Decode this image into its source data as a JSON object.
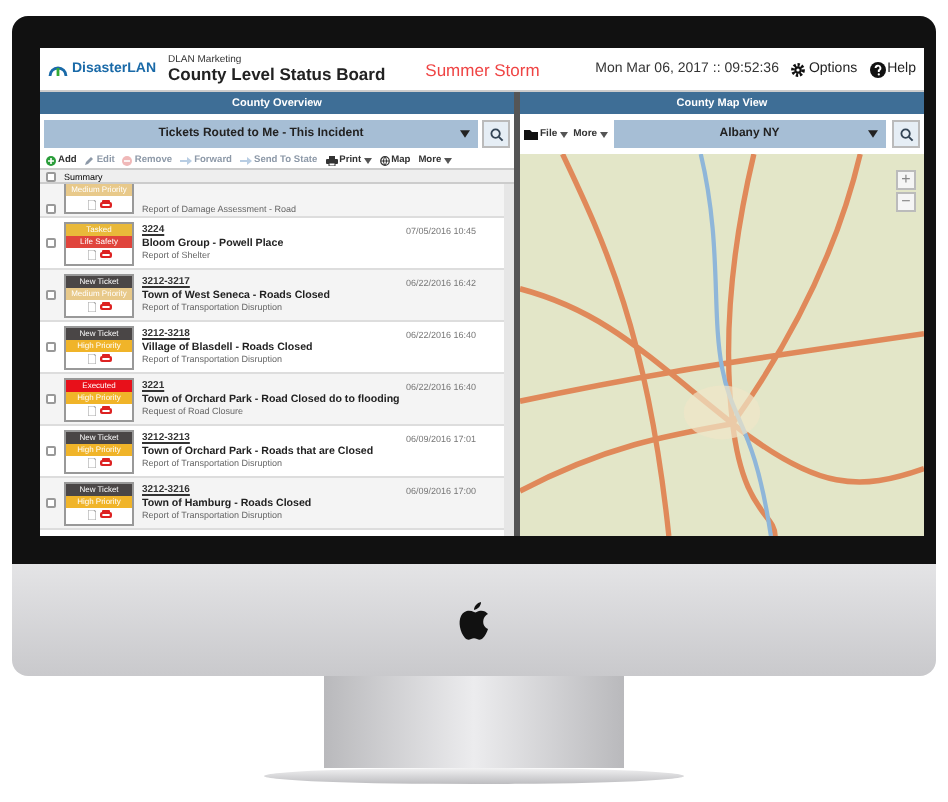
{
  "header": {
    "org": "DLAN Marketing",
    "logo_text": "DisasterLAN",
    "title": "County Level Status Board",
    "incident": "Summer Storm",
    "datetime": "Mon Mar 06, 2017 :: 09:52:36",
    "links": [
      {
        "kind": "options",
        "label": "Options"
      },
      {
        "kind": "help",
        "label": "Help"
      }
    ]
  },
  "overview": {
    "title": "County Overview",
    "filter": "Tickets Routed to Me - This Incident",
    "toolbar": [
      {
        "kind": "add",
        "label": "Add",
        "disabled": false
      },
      {
        "kind": "edit",
        "label": "Edit",
        "disabled": true
      },
      {
        "kind": "remove",
        "label": "Remove",
        "disabled": true
      },
      {
        "kind": "forward",
        "label": "Forward",
        "disabled": true
      },
      {
        "kind": "send",
        "label": "Send To State",
        "disabled": true
      },
      {
        "kind": "print",
        "label": "Print",
        "disabled": false,
        "menu": true
      },
      {
        "kind": "map",
        "label": "Map",
        "disabled": false
      },
      {
        "kind": "more",
        "label": "More",
        "disabled": false,
        "menu": true
      }
    ],
    "column": "Summary",
    "all_checked": false,
    "rows": [
      {
        "checked": false,
        "number": "",
        "date": "",
        "title": "",
        "subtitle": "Report of Damage Assessment - Road",
        "tags": [
          {
            "label": "Medium Priority",
            "color": "#e8c98a"
          }
        ]
      },
      {
        "checked": false,
        "number": "3224",
        "date": "07/05/2016 10:45",
        "title": "Bloom Group - Powell Place",
        "subtitle": "Report of Shelter",
        "tags": [
          {
            "label": "Tasked",
            "color": "#e9b93a"
          },
          {
            "label": "Life Safety",
            "color": "#e0443c"
          }
        ]
      },
      {
        "checked": false,
        "number": "3212-3217",
        "date": "06/22/2016 16:42",
        "title": "Town of West Seneca - Roads Closed",
        "subtitle": "Report of Transportation Disruption",
        "tags": [
          {
            "label": "New Ticket",
            "color": "#4a4646"
          },
          {
            "label": "Medium Priority",
            "color": "#e8c98a"
          }
        ]
      },
      {
        "checked": false,
        "number": "3212-3218",
        "date": "06/22/2016 16:40",
        "title": "Village of Blasdell - Roads Closed",
        "subtitle": "Report of Transportation Disruption",
        "tags": [
          {
            "label": "New Ticket",
            "color": "#4a4646"
          },
          {
            "label": "High Priority",
            "color": "#f0b429"
          }
        ]
      },
      {
        "checked": false,
        "number": "3221",
        "date": "06/22/2016 16:40",
        "title": "Town of Orchard Park - Road Closed do to flooding",
        "subtitle": "Request of Road Closure",
        "tags": [
          {
            "label": "Executed",
            "color": "#e8101a"
          },
          {
            "label": "High Priority",
            "color": "#f0b429"
          }
        ]
      },
      {
        "checked": false,
        "number": "3212-3213",
        "date": "06/09/2016 17:01",
        "title": "Town of Orchard Park - Roads that are Closed",
        "subtitle": "Report of Transportation Disruption",
        "tags": [
          {
            "label": "New Ticket",
            "color": "#4a4646"
          },
          {
            "label": "High Priority",
            "color": "#f0b429"
          }
        ]
      },
      {
        "checked": false,
        "number": "3212-3216",
        "date": "06/09/2016 17:00",
        "title": "Town of Hamburg - Roads Closed",
        "subtitle": "Report of Transportation Disruption",
        "tags": [
          {
            "label": "New Ticket",
            "color": "#4a4646"
          },
          {
            "label": "High Priority",
            "color": "#f0b429"
          }
        ]
      }
    ]
  },
  "map_view": {
    "title": "County Map View",
    "menus": [
      "File",
      "More"
    ],
    "location": "Albany NY",
    "zoom": [
      "+",
      "−"
    ]
  }
}
